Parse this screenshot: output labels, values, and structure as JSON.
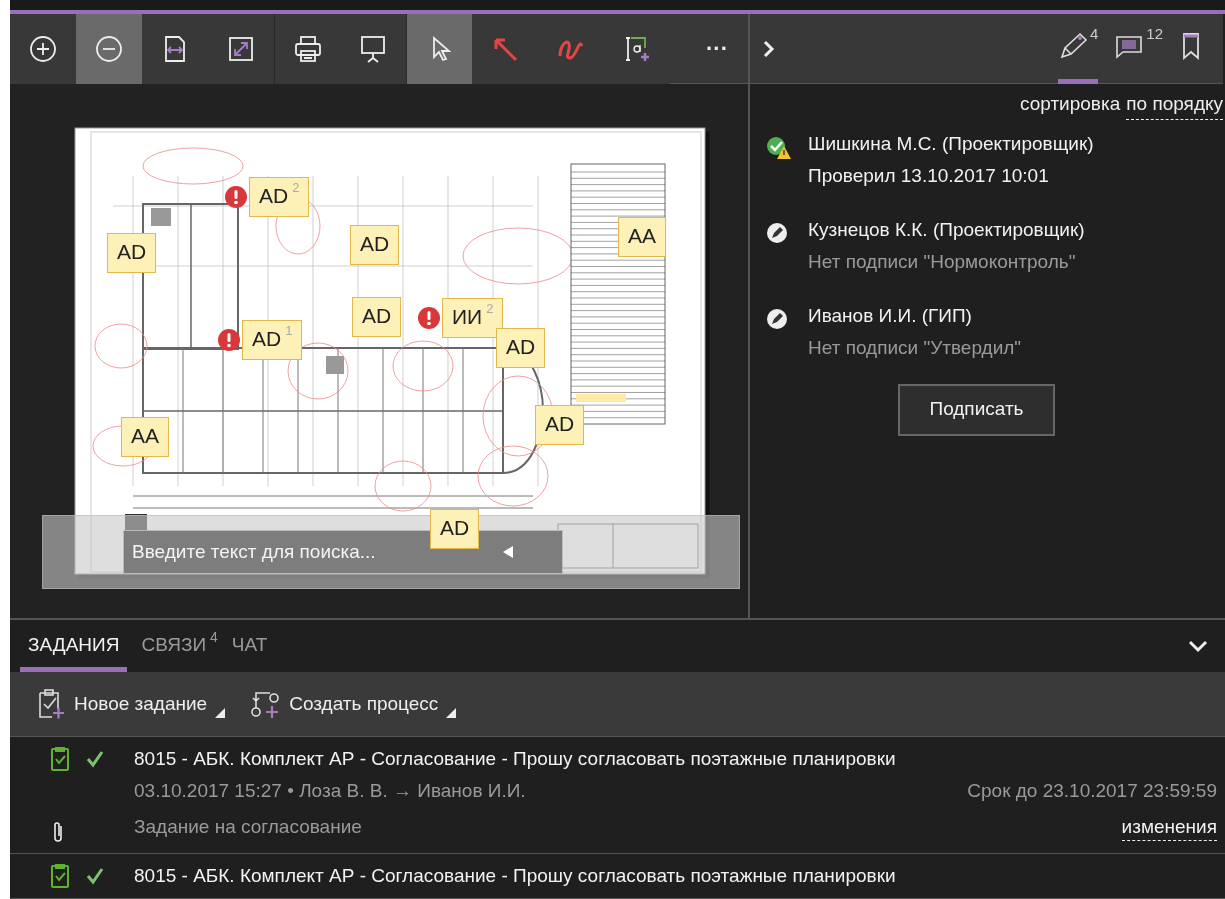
{
  "toolbar": {
    "buttons": [
      {
        "kind": "zoom-in",
        "selected": false
      },
      {
        "kind": "zoom-out",
        "selected": true
      },
      {
        "kind": "fit-width",
        "selected": false
      },
      {
        "kind": "fit-page",
        "selected": false
      },
      {
        "kind": "print",
        "selected": false
      },
      {
        "kind": "present",
        "selected": false
      },
      {
        "kind": "pointer",
        "selected": true
      },
      {
        "kind": "arrow",
        "selected": false
      },
      {
        "kind": "freehand",
        "selected": false
      },
      {
        "kind": "text",
        "selected": false
      }
    ],
    "more": "···"
  },
  "document": {
    "annotations": [
      {
        "label": "AD",
        "count": "2",
        "alert": true
      },
      {
        "label": "AD"
      },
      {
        "label": "AD"
      },
      {
        "label": "AA"
      },
      {
        "label": "AD"
      },
      {
        "label": "ИИ",
        "count": "2",
        "alert": true
      },
      {
        "label": "AD",
        "count": "1",
        "alert": true
      },
      {
        "label": "AD"
      },
      {
        "label": "AA"
      },
      {
        "label": "AD"
      },
      {
        "label": "AD"
      }
    ],
    "search": {
      "placeholder": "Введите текст для поиска..."
    }
  },
  "side_panel": {
    "tabs": [
      {
        "kind": "markup",
        "count": "4",
        "selected": true
      },
      {
        "kind": "comments",
        "count": "12",
        "selected": false
      },
      {
        "kind": "bookmarks",
        "selected": false
      }
    ],
    "sort_label": "сортировка",
    "sort_value": "по порядку",
    "signers": [
      {
        "name": "Шишкина М.С. (Проектировщик)",
        "status": "Проверил 13.10.2017 10:01",
        "kind": "signed_warning"
      },
      {
        "name": "Кузнецов К.К. (Проектировщик)",
        "status": "Нет подписи \"Нормоконтроль\"",
        "kind": "unsigned"
      },
      {
        "name": "Иванов И.И. (ГИП)",
        "status": "Нет подписи \"Утвердил\"",
        "kind": "unsigned"
      }
    ],
    "sign_button": "Подписать"
  },
  "bottom_panel": {
    "tabs": [
      {
        "label": "ЗАДАНИЯ",
        "selected": true
      },
      {
        "label": "СВЯЗИ",
        "count": "4",
        "selected": false
      },
      {
        "label": "ЧАТ",
        "selected": false
      }
    ],
    "actions": [
      {
        "kind": "new-task",
        "label": "Новое задание"
      },
      {
        "kind": "new-process",
        "label": "Создать процесс"
      }
    ],
    "tasks": [
      {
        "title": "8015 - АБК. Комплект АР - Согласование - Прошу согласовать поэтажные планировки",
        "done": true,
        "meta": "03.10.2017 15:27 • Лоза В. В. → Иванов И.И.",
        "due": "Срок до 23.10.2017 23:59:59",
        "description": "Задание на согласование",
        "link": "изменения",
        "attachment": true
      },
      {
        "title": "8015 - АБК. Комплект АР - Согласование - Прошу согласовать поэтажные планировки",
        "done": true
      }
    ]
  }
}
